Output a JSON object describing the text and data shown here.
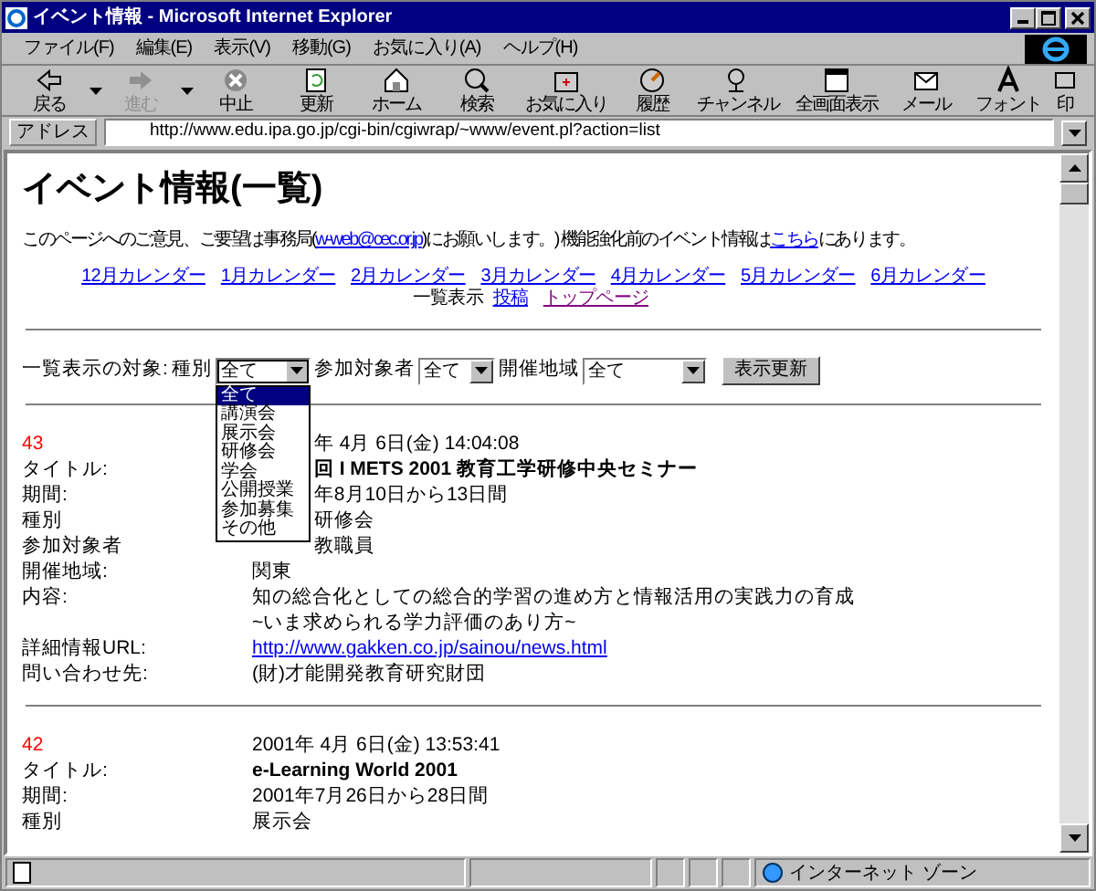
{
  "window": {
    "title": "イベント情報 - Microsoft Internet Explorer"
  },
  "menu": [
    "ファイル(F)",
    "編集(E)",
    "表示(V)",
    "移動(G)",
    "お気に入り(A)",
    "ヘルプ(H)"
  ],
  "toolbar": [
    {
      "label": "戻る",
      "disabled": false,
      "dropdown": true
    },
    {
      "label": "進む",
      "disabled": true,
      "dropdown": true
    },
    {
      "label": "中止",
      "disabled": false,
      "dropdown": false
    },
    {
      "label": "更新",
      "disabled": false,
      "dropdown": false
    },
    {
      "label": "ホーム",
      "disabled": false,
      "dropdown": false
    },
    {
      "label": "検索",
      "disabled": false,
      "dropdown": false
    },
    {
      "label": "お気に入り",
      "disabled": false,
      "dropdown": false
    },
    {
      "label": "履歴",
      "disabled": false,
      "dropdown": false
    },
    {
      "label": "チャンネル",
      "disabled": false,
      "dropdown": false
    },
    {
      "label": "全画面表示",
      "disabled": false,
      "dropdown": false
    },
    {
      "label": "メール",
      "disabled": false,
      "dropdown": false
    },
    {
      "label": "フォント",
      "disabled": false,
      "dropdown": false
    },
    {
      "label": "印",
      "disabled": false,
      "dropdown": false
    }
  ],
  "address": {
    "label": "アドレス",
    "value": "http://www.edu.ipa.go.jp/cgi-bin/cgiwrap/~www/event.pl?action=list"
  },
  "page": {
    "heading": "イベント情報(一覧)",
    "notice": [
      {
        "kind": "text",
        "text": "このページへのご意見、ご要望は事務局("
      },
      {
        "kind": "link",
        "text": "w-web@cec.or.jp"
      },
      {
        "kind": "text",
        "text": ")にお願いします。) 機能強化前のイベント情報は"
      },
      {
        "kind": "link",
        "text": "こちら"
      },
      {
        "kind": "text",
        "text": "にあります。"
      }
    ],
    "calendar_links": [
      "12月カレンダー",
      "1月カレンダー",
      "2月カレンダー",
      "3月カレンダー",
      "4月カレンダー",
      "5月カレンダー",
      "6月カレンダー"
    ],
    "current": "一覧表示",
    "nav_links": [
      {
        "text": "投稿",
        "visited": false
      },
      {
        "text": "トップページ",
        "visited": true
      }
    ],
    "filter": {
      "label": "一覧表示の対象:",
      "selects": [
        {
          "label": "種別",
          "value": "全て",
          "open": true
        },
        {
          "label": "参加対象者",
          "value": "全て",
          "open": false
        },
        {
          "label": "開催地域",
          "value": "全て",
          "open": false
        }
      ],
      "options": [
        {
          "text": "全て",
          "selected": true
        },
        {
          "text": "講演会",
          "selected": false
        },
        {
          "text": "展示会",
          "selected": false
        },
        {
          "text": "研修会",
          "selected": false
        },
        {
          "text": "学会",
          "selected": false
        },
        {
          "text": "公開授業",
          "selected": false
        },
        {
          "text": "参加募集",
          "selected": false
        },
        {
          "text": "その他",
          "selected": false
        }
      ],
      "button": "表示更新"
    },
    "events": [
      {
        "number": "43",
        "fields": [
          {
            "kind": "plain",
            "lines": [
              "年 4月 6日(金) 14:04:08"
            ]
          },
          {
            "kind": "title",
            "label": "タイトル:",
            "lines": [
              "回 I METS 2001  教育工学研修中央セミナー"
            ]
          },
          {
            "kind": "plain",
            "label": "期間:",
            "lines": [
              "年8月10日から13日間"
            ]
          },
          {
            "kind": "plain",
            "label": "種別",
            "lines": [
              "研修会"
            ]
          },
          {
            "kind": "plain",
            "label": "参加対象者",
            "lines": [
              "教職員"
            ]
          },
          {
            "kind": "plain",
            "label": "開催地域:",
            "lines": [
              "関東"
            ]
          },
          {
            "kind": "plain",
            "label": "内容:",
            "lines": [
              "知の総合化としての総合的学習の進め方と情報活用の実践力の育成",
              "~いま求められる学力評価のあり方~"
            ]
          },
          {
            "kind": "link",
            "label": "詳細情報URL:",
            "lines": [
              "http://www.gakken.co.jp/sainou/news.html"
            ]
          },
          {
            "kind": "plain",
            "label": "問い合わせ先:",
            "lines": [
              "(財)才能開発教育研究財団"
            ]
          }
        ]
      },
      {
        "number": "42",
        "fields": [
          {
            "kind": "plain",
            "lines": [
              "2001年 4月 6日(金) 13:53:41"
            ]
          },
          {
            "kind": "title",
            "label": "タイトル:",
            "lines": [
              "e-Learning World 2001"
            ]
          },
          {
            "kind": "plain",
            "label": "期間:",
            "lines": [
              "2001年7月26日から28日間"
            ]
          },
          {
            "kind": "plain",
            "label": "種別",
            "lines": [
              "展示会"
            ]
          }
        ]
      }
    ]
  },
  "status_bar": {
    "zone": "インターネット ゾーン"
  }
}
